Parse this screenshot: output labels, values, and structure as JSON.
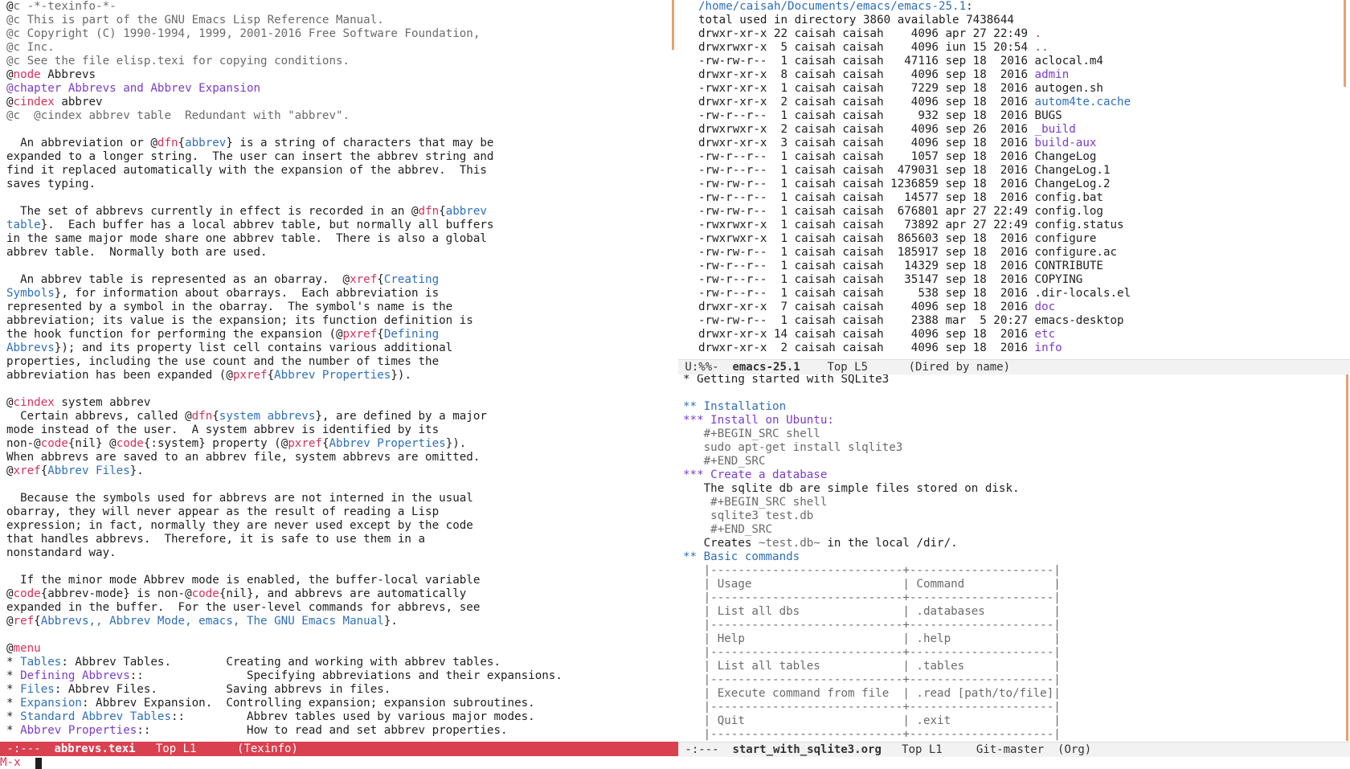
{
  "left_buffer": {
    "lines": [
      [
        [
          "c-default",
          "@"
        ],
        [
          "c-comment",
          "c -*-texinfo-*-"
        ]
      ],
      [
        [
          "c-comment",
          "@c This is part of the GNU Emacs Lisp Reference Manual."
        ]
      ],
      [
        [
          "c-comment",
          "@c Copyright (C) 1990-1994, 1999, 2001-2016 Free Software Foundation,"
        ]
      ],
      [
        [
          "c-comment",
          "@c Inc."
        ]
      ],
      [
        [
          "c-comment",
          "@c See the file elisp.texi for copying conditions."
        ]
      ],
      [
        [
          "c-default",
          "@"
        ],
        [
          "c-keyword",
          "node"
        ],
        [
          "c-default",
          " Abbrevs"
        ]
      ],
      [
        [
          "c-purple",
          "@chapter Abbrevs and Abbrev Expansion"
        ]
      ],
      [
        [
          "c-default",
          "@"
        ],
        [
          "c-keyword",
          "cindex"
        ],
        [
          "c-default",
          " abbrev"
        ]
      ],
      [
        [
          "c-comment",
          "@c  @cindex abbrev table  Redundant with \"abbrev\"."
        ]
      ],
      [
        [
          "c-default",
          ""
        ]
      ],
      [
        [
          "c-default",
          "  An abbreviation or @"
        ],
        [
          "c-keyword",
          "dfn"
        ],
        [
          "c-default",
          "{"
        ],
        [
          "c-link",
          "abbrev"
        ],
        [
          "c-default",
          "} is a string of characters that may be"
        ]
      ],
      [
        [
          "c-default",
          "expanded to a longer string.  The user can insert the abbrev string and"
        ]
      ],
      [
        [
          "c-default",
          "find it replaced automatically with the expansion of the abbrev.  This"
        ]
      ],
      [
        [
          "c-default",
          "saves typing."
        ]
      ],
      [
        [
          "c-default",
          ""
        ]
      ],
      [
        [
          "c-default",
          "  The set of abbrevs currently in effect is recorded in an @"
        ],
        [
          "c-keyword",
          "dfn"
        ],
        [
          "c-default",
          "{"
        ],
        [
          "c-link",
          "abbrev"
        ]
      ],
      [
        [
          "c-link",
          "table"
        ],
        [
          "c-default",
          "}.  Each buffer has a local abbrev table, but normally all buffers"
        ]
      ],
      [
        [
          "c-default",
          "in the same major mode share one abbrev table.  There is also a global"
        ]
      ],
      [
        [
          "c-default",
          "abbrev table.  Normally both are used."
        ]
      ],
      [
        [
          "c-default",
          ""
        ]
      ],
      [
        [
          "c-default",
          "  An abbrev table is represented as an obarray.  @"
        ],
        [
          "c-keyword",
          "xref"
        ],
        [
          "c-default",
          "{"
        ],
        [
          "c-link",
          "Creating"
        ]
      ],
      [
        [
          "c-link",
          "Symbols"
        ],
        [
          "c-default",
          "}, for information about obarrays.  Each abbreviation is"
        ]
      ],
      [
        [
          "c-default",
          "represented by a symbol in the obarray.  The symbol's name is the"
        ]
      ],
      [
        [
          "c-default",
          "abbreviation; its value is the expansion; its function definition is"
        ]
      ],
      [
        [
          "c-default",
          "the hook function for performing the expansion (@"
        ],
        [
          "c-keyword",
          "pxref"
        ],
        [
          "c-default",
          "{"
        ],
        [
          "c-link",
          "Defining"
        ]
      ],
      [
        [
          "c-link",
          "Abbrevs"
        ],
        [
          "c-default",
          "}); and its property list cell contains various additional"
        ]
      ],
      [
        [
          "c-default",
          "properties, including the use count and the number of times the"
        ]
      ],
      [
        [
          "c-default",
          "abbreviation has been expanded (@"
        ],
        [
          "c-keyword",
          "pxref"
        ],
        [
          "c-default",
          "{"
        ],
        [
          "c-link",
          "Abbrev Properties"
        ],
        [
          "c-default",
          "})."
        ]
      ],
      [
        [
          "c-default",
          ""
        ]
      ],
      [
        [
          "c-default",
          "@"
        ],
        [
          "c-keyword",
          "cindex"
        ],
        [
          "c-default",
          " system abbrev"
        ]
      ],
      [
        [
          "c-default",
          "  Certain abbrevs, called @"
        ],
        [
          "c-keyword",
          "dfn"
        ],
        [
          "c-default",
          "{"
        ],
        [
          "c-link",
          "system abbrevs"
        ],
        [
          "c-default",
          "}, are defined by a major"
        ]
      ],
      [
        [
          "c-default",
          "mode instead of the user.  A system abbrev is identified by its"
        ]
      ],
      [
        [
          "c-default",
          "non-@"
        ],
        [
          "c-keyword",
          "code"
        ],
        [
          "c-default",
          "{nil} @"
        ],
        [
          "c-keyword",
          "code"
        ],
        [
          "c-default",
          "{:system} property (@"
        ],
        [
          "c-keyword",
          "pxref"
        ],
        [
          "c-default",
          "{"
        ],
        [
          "c-link",
          "Abbrev Properties"
        ],
        [
          "c-default",
          "})."
        ]
      ],
      [
        [
          "c-default",
          "When abbrevs are saved to an abbrev file, system abbrevs are omitted."
        ]
      ],
      [
        [
          "c-default",
          "@"
        ],
        [
          "c-keyword",
          "xref"
        ],
        [
          "c-default",
          "{"
        ],
        [
          "c-link",
          "Abbrev Files"
        ],
        [
          "c-default",
          "}."
        ]
      ],
      [
        [
          "c-default",
          ""
        ]
      ],
      [
        [
          "c-default",
          "  Because the symbols used for abbrevs are not interned in the usual"
        ]
      ],
      [
        [
          "c-default",
          "obarray, they will never appear as the result of reading a Lisp"
        ]
      ],
      [
        [
          "c-default",
          "expression; in fact, normally they are never used except by the code"
        ]
      ],
      [
        [
          "c-default",
          "that handles abbrevs.  Therefore, it is safe to use them in a"
        ]
      ],
      [
        [
          "c-default",
          "nonstandard way."
        ]
      ],
      [
        [
          "c-default",
          ""
        ]
      ],
      [
        [
          "c-default",
          "  If the minor mode Abbrev mode is enabled, the buffer-local variable"
        ]
      ],
      [
        [
          "c-default",
          "@"
        ],
        [
          "c-keyword",
          "code"
        ],
        [
          "c-default",
          "{abbrev-mode} is non-@"
        ],
        [
          "c-keyword",
          "code"
        ],
        [
          "c-default",
          "{nil}, and abbrevs are automatically"
        ]
      ],
      [
        [
          "c-default",
          "expanded in the buffer.  For the user-level commands for abbrevs, see"
        ]
      ],
      [
        [
          "c-default",
          "@"
        ],
        [
          "c-keyword",
          "ref"
        ],
        [
          "c-default",
          "{"
        ],
        [
          "c-link",
          "Abbrevs,, Abbrev Mode, emacs, The GNU Emacs Manual"
        ],
        [
          "c-default",
          "}."
        ]
      ],
      [
        [
          "c-default",
          ""
        ]
      ],
      [
        [
          "c-default",
          "@"
        ],
        [
          "c-keyword",
          "menu"
        ]
      ],
      [
        [
          "c-default",
          "* "
        ],
        [
          "c-link",
          "Tables"
        ],
        [
          "c-default",
          ": Abbrev Tables.        Creating and working with abbrev tables."
        ]
      ],
      [
        [
          "c-default",
          "* "
        ],
        [
          "c-purple",
          "Defining Abbrevs"
        ],
        [
          "c-default",
          "::               Specifying abbreviations and their expansions."
        ]
      ],
      [
        [
          "c-default",
          "* "
        ],
        [
          "c-link",
          "Files"
        ],
        [
          "c-default",
          ": Abbrev Files.          Saving abbrevs in files."
        ]
      ],
      [
        [
          "c-default",
          "* "
        ],
        [
          "c-link",
          "Expansion"
        ],
        [
          "c-default",
          ": Abbrev Expansion.  Controlling expansion; expansion subroutines."
        ]
      ],
      [
        [
          "c-default",
          "* "
        ],
        [
          "c-link",
          "Standard Abbrev Tables"
        ],
        [
          "c-default",
          "::         Abbrev tables used by various major modes."
        ]
      ],
      [
        [
          "c-default",
          "* "
        ],
        [
          "c-purple",
          "Abbrev Properties"
        ],
        [
          "c-default",
          "::              How to read and set abbrev properties."
        ]
      ]
    ]
  },
  "dired_buffer": {
    "lines": [
      [
        [
          "c-link",
          "/home/caisah/Documents/emacs/emacs-25.1"
        ],
        [
          "c-default",
          ":"
        ]
      ],
      [
        [
          "c-default",
          "total used in directory 3860 available 7438644"
        ]
      ],
      [
        [
          "c-default",
          "drwxr-xr-x 22 caisah caisah    4096 apr 27 22:49 "
        ],
        [
          "c-dir",
          "."
        ]
      ],
      [
        [
          "c-default",
          "drwxrwxr-x  5 caisah caisah    4096 iun 15 20:54 "
        ],
        [
          "c-dir",
          ".."
        ]
      ],
      [
        [
          "c-default",
          "-rw-rw-r--  1 caisah caisah   47116 sep 18  2016 aclocal.m4"
        ]
      ],
      [
        [
          "c-default",
          "drwxr-xr-x  8 caisah caisah    4096 sep 18  2016 "
        ],
        [
          "c-dir",
          "admin"
        ]
      ],
      [
        [
          "c-default",
          "-rwxr-xr-x  1 caisah caisah    7229 sep 18  2016 autogen.sh"
        ]
      ],
      [
        [
          "c-default",
          "drwxr-xr-x  2 caisah caisah    4096 sep 18  2016 "
        ],
        [
          "c-link",
          "autom4te.cache"
        ]
      ],
      [
        [
          "c-default",
          "-rw-r--r--  1 caisah caisah     932 sep 18  2016 BUGS"
        ]
      ],
      [
        [
          "c-default",
          "drwxrwxr-x  2 caisah caisah    4096 sep 26  2016 "
        ],
        [
          "c-dir",
          "_build"
        ]
      ],
      [
        [
          "c-default",
          "drwxr-xr-x  3 caisah caisah    4096 sep 18  2016 "
        ],
        [
          "c-dir",
          "build-aux"
        ]
      ],
      [
        [
          "c-default",
          "-rw-r--r--  1 caisah caisah    1057 sep 18  2016 ChangeLog"
        ]
      ],
      [
        [
          "c-default",
          "-rw-r--r--  1 caisah caisah  479031 sep 18  2016 ChangeLog.1"
        ]
      ],
      [
        [
          "c-default",
          "-rw-rw-r--  1 caisah caisah 1236859 sep 18  2016 ChangeLog.2"
        ]
      ],
      [
        [
          "c-default",
          "-rw-r--r--  1 caisah caisah   14577 sep 18  2016 config.bat"
        ]
      ],
      [
        [
          "c-default",
          "-rw-rw-r--  1 caisah caisah  676801 apr 27 22:49 config.log"
        ]
      ],
      [
        [
          "c-default",
          "-rwxrwxr-x  1 caisah caisah   73892 apr 27 22:49 config.status"
        ]
      ],
      [
        [
          "c-default",
          "-rwxrwxr-x  1 caisah caisah  865603 sep 18  2016 configure"
        ]
      ],
      [
        [
          "c-default",
          "-rw-rw-r--  1 caisah caisah  185917 sep 18  2016 configure.ac"
        ]
      ],
      [
        [
          "c-default",
          "-rw-r--r--  1 caisah caisah   14329 sep 18  2016 CONTRIBUTE"
        ]
      ],
      [
        [
          "c-default",
          "-rw-r--r--  1 caisah caisah   35147 sep 18  2016 COPYING"
        ]
      ],
      [
        [
          "c-default",
          "-rw-r--r--  1 caisah caisah     538 sep 18  2016 .dir-locals.el"
        ]
      ],
      [
        [
          "c-default",
          "drwxr-xr-x  7 caisah caisah    4096 sep 18  2016 "
        ],
        [
          "c-dir",
          "doc"
        ]
      ],
      [
        [
          "c-default",
          "-rw-rw-r--  1 caisah caisah    2388 mar  5 20:27 emacs-desktop"
        ]
      ],
      [
        [
          "c-default",
          "drwxr-xr-x 14 caisah caisah    4096 sep 18  2016 "
        ],
        [
          "c-dir",
          "etc"
        ]
      ],
      [
        [
          "c-default",
          "drwxr-xr-x  2 caisah caisah    4096 sep 18  2016 "
        ],
        [
          "c-dir",
          "info"
        ]
      ]
    ]
  },
  "org_buffer": {
    "lines": [
      [
        [
          "c-default",
          "* Getting started with SQLite3"
        ]
      ],
      [
        [
          "c-default",
          ""
        ]
      ],
      [
        [
          "c-head",
          "** Installation"
        ]
      ],
      [
        [
          "c-sub",
          "*** Install on Ubuntu:"
        ]
      ],
      [
        [
          "c-code",
          "   #+BEGIN_SRC shell"
        ]
      ],
      [
        [
          "c-code",
          "   sudo apt-get install slqlite3"
        ]
      ],
      [
        [
          "c-code",
          "   #+END_SRC"
        ]
      ],
      [
        [
          "c-sub",
          "*** Create a database"
        ]
      ],
      [
        [
          "c-default",
          "   The sqlite db are simple files stored on disk."
        ]
      ],
      [
        [
          "c-code",
          "    #+BEGIN_SRC shell"
        ]
      ],
      [
        [
          "c-code",
          "    sqlite3 test.db"
        ]
      ],
      [
        [
          "c-code",
          "    #+END_SRC"
        ]
      ],
      [
        [
          "c-default",
          "   Creates "
        ],
        [
          "c-code",
          "~test.db~"
        ],
        [
          "c-default",
          " in the local "
        ],
        [
          "c-default",
          "/dir/"
        ],
        [
          "c-default",
          "."
        ]
      ],
      [
        [
          "c-head",
          "** Basic commands"
        ]
      ],
      [
        [
          "c-code",
          "   |----------------------------+---------------------|"
        ]
      ],
      [
        [
          "c-code",
          "   | Usage                      | Command             |"
        ]
      ],
      [
        [
          "c-code",
          "   |----------------------------+---------------------|"
        ]
      ],
      [
        [
          "c-code",
          "   | List all dbs               | .databases          |"
        ]
      ],
      [
        [
          "c-code",
          "   |----------------------------+---------------------|"
        ]
      ],
      [
        [
          "c-code",
          "   | Help                       | .help               |"
        ]
      ],
      [
        [
          "c-code",
          "   |----------------------------+---------------------|"
        ]
      ],
      [
        [
          "c-code",
          "   | List all tables            | .tables             |"
        ]
      ],
      [
        [
          "c-code",
          "   |----------------------------+---------------------|"
        ]
      ],
      [
        [
          "c-code",
          "   | Execute command from file  | .read [path/to/file]|"
        ]
      ],
      [
        [
          "c-code",
          "   |----------------------------+---------------------|"
        ]
      ],
      [
        [
          "c-code",
          "   | Quit                       | .exit               |"
        ]
      ],
      [
        [
          "c-code",
          "   |----------------------------+---------------------|"
        ]
      ]
    ]
  },
  "modeline_left": {
    "status": " -:---  ",
    "buffer": "abbrevs.texi",
    "position": "   Top L1",
    "mode": "      (Texinfo)"
  },
  "modeline_right_top": {
    "status": " U:%%-  ",
    "buffer": "emacs-25.1",
    "position": "    Top L5",
    "mode": "      (Dired by name)"
  },
  "modeline_right_bottom": {
    "status": " -:---  ",
    "buffer": "start_with_sqlite3.org",
    "position": "   Top L1",
    "vc": "     Git-master",
    "mode": "  (Org)"
  },
  "minibuffer": {
    "prompt": "M-x "
  }
}
